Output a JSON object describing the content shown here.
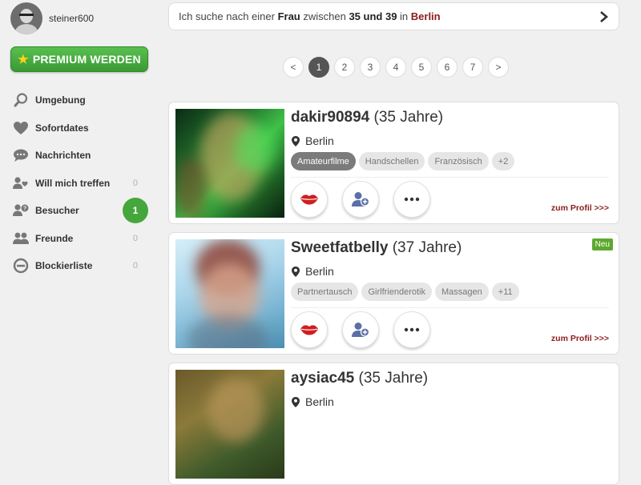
{
  "user": {
    "name": "steiner600"
  },
  "premium": {
    "label": "PREMIUM WERDEN"
  },
  "nav": {
    "items": [
      {
        "label": "Umgebung",
        "icon": "search-icon"
      },
      {
        "label": "Sofortdates",
        "icon": "heart-icon"
      },
      {
        "label": "Nachrichten",
        "icon": "chat-icon"
      },
      {
        "label": "Will mich treffen",
        "icon": "users-heart-icon",
        "count": "0"
      },
      {
        "label": "Besucher",
        "icon": "user-question-icon",
        "badge": "1"
      },
      {
        "label": "Freunde",
        "icon": "friends-icon",
        "count": "0"
      },
      {
        "label": "Blockierliste",
        "icon": "block-icon",
        "count": "0"
      }
    ]
  },
  "search": {
    "prefix": "Ich suche nach einer ",
    "gender": "Frau",
    "mid": " zwischen ",
    "range": "35 und 39",
    "in": " in ",
    "city": "Berlin"
  },
  "pager": {
    "prev": "<",
    "pages": [
      "1",
      "2",
      "3",
      "4",
      "5",
      "6",
      "7"
    ],
    "current": "1",
    "next": ">"
  },
  "profiles": [
    {
      "name": "dakir90894",
      "age": "(35 Jahre)",
      "city": "Berlin",
      "tags": [
        "Amateurfilme",
        "Handschellen",
        "Französisch",
        "+2"
      ],
      "active_tag": 0,
      "link": "zum Profil >>>",
      "new": ""
    },
    {
      "name": "Sweetfatbelly",
      "age": "(37 Jahre)",
      "city": "Berlin",
      "tags": [
        "Partnertausch",
        "Girlfrienderotik",
        "Massagen",
        "+11"
      ],
      "active_tag": -1,
      "link": "zum Profil >>>",
      "new": "Neu"
    },
    {
      "name": "aysiac45",
      "age": "(35 Jahre)",
      "city": "Berlin",
      "tags": [],
      "active_tag": -1,
      "link": "",
      "new": ""
    }
  ],
  "colors": {
    "accent_green": "#45a73b",
    "link_red": "#8b1c1c",
    "background": "#f0f0f0"
  }
}
